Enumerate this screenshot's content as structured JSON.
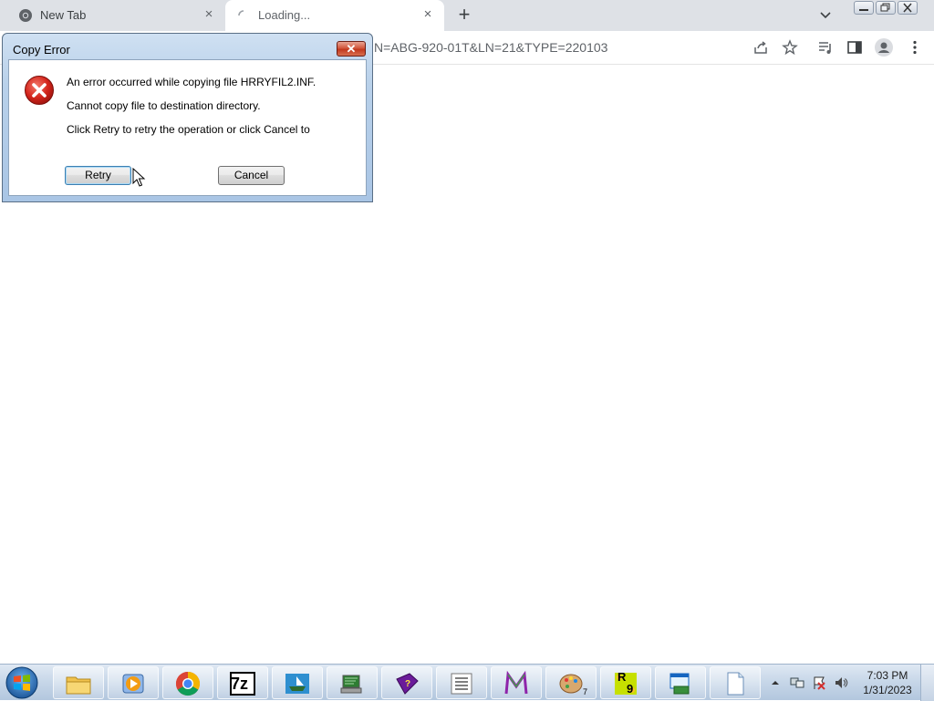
{
  "browser": {
    "tabs": [
      {
        "title": "New Tab",
        "close": "×"
      },
      {
        "title": "Loading...",
        "close": "×"
      }
    ],
    "new_tab": "+",
    "url_visible": "N=ABG-920-01T&LN=21&TYPE=220103"
  },
  "dialog": {
    "title": "Copy Error",
    "close": "✕",
    "lines": [
      "An error occurred while copying file HRRYFIL2.INF.",
      "Cannot copy file to destination directory.",
      "Click Retry to retry the operation or click Cancel to"
    ],
    "retry_label": "Retry",
    "cancel_label": "Cancel"
  },
  "taskbar": {
    "apps": [
      "file-explorer",
      "media-player",
      "chrome",
      "7zip",
      "ship-app",
      "network-app",
      "help-book",
      "list-app",
      "m-app",
      "paint-app",
      "r9-app",
      "installer-app",
      "blank-document"
    ],
    "badge_7z": "7z",
    "paint_count": "7",
    "r9_top": "R",
    "r9_bottom": "9",
    "clock_time": "7:03 PM",
    "clock_date": "1/31/2023"
  },
  "colors": {
    "dialog_frame": "#a9c5e5",
    "close_red": "#c2381d",
    "taskbar": "#c6d6e8"
  }
}
